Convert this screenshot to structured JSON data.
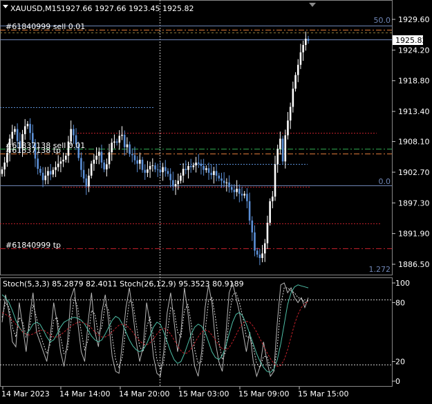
{
  "header": {
    "symbol_label": "XAUUSD,M15",
    "ohlc": "1927.66 1927.66 1923.45 1925.82"
  },
  "price_axis": {
    "ticks": [
      1929.6,
      1924.2,
      1918.8,
      1913.4,
      1908.1,
      1902.7,
      1897.3,
      1891.9,
      1886.5
    ],
    "tick_labels": [
      "1929.60",
      "1924.20",
      "1918.80",
      "1913.40",
      "1908.10",
      "1902.70",
      "1897.30",
      "1891.90",
      "1886.50"
    ],
    "current_price": 1925.82,
    "current_label": "1925.82"
  },
  "time_axis": {
    "labels": [
      "14 Mar 2023",
      "14 Mar 14:00",
      "14 Mar 20:00",
      "15 Mar 03:00",
      "15 Mar 09:00",
      "15 Mar 15:00"
    ]
  },
  "fibo": {
    "high_label": "50.0",
    "mid_label": "0.0",
    "low_label": "1.272"
  },
  "trade_labels": {
    "order1_sell": "#61840999 sell 0.01",
    "order2_sell": "#61837138 sell 0.01",
    "order2_tp": "#61837138 tp",
    "order1_tp": "#61840999 tp"
  },
  "indicator": {
    "title": "Stoch(5,3,3) 85.2879 82.4011  Stoch(26,12,9) 95.3523 80.9189",
    "ticks": [
      100,
      80,
      20,
      0
    ],
    "tick_labels": [
      "100",
      "80",
      "20",
      "0"
    ]
  },
  "colors": {
    "background": "#000000",
    "bull": "#ffffff",
    "bear": "#5b8fd6",
    "grid": "#c8c8c8",
    "fibo": "#6f86b6",
    "sell_level": "#e07b39",
    "tp_level": "#c0202a",
    "green_level": "#2fa84f",
    "stoch_fast_main": "#b8b8b8",
    "stoch_fast_signal": "#e0e0e0",
    "stoch_slow_main": "#4fc0a8",
    "stoch_slow_signal": "#c0202a"
  },
  "chart_data": {
    "type": "candlestick",
    "symbol": "XAUUSD",
    "timeframe": "M15",
    "ylim": [
      1884.5,
      1931.5
    ],
    "x_tick_labels": [
      "14 Mar 2023",
      "14 Mar 14:00",
      "14 Mar 20:00",
      "15 Mar 03:00",
      "15 Mar 09:00",
      "15 Mar 15:00"
    ],
    "close": [
      1903.2,
      1904.4,
      1906.1,
      1908.6,
      1909.8,
      1910.3,
      1908.2,
      1906.9,
      1909.4,
      1910.8,
      1911.2,
      1909.6,
      1907.8,
      1905.1,
      1903.3,
      1902.6,
      1901.3,
      1902.1,
      1902.9,
      1902.3,
      1903.1,
      1903.6,
      1904.2,
      1904.6,
      1904.9,
      1905.6,
      1908.1,
      1910.3,
      1909.2,
      1907.6,
      1905.2,
      1903.1,
      1901.6,
      1900.2,
      1902.1,
      1904.2,
      1904.9,
      1905.6,
      1906.3,
      1904.4,
      1903.2,
      1904.1,
      1906.2,
      1907.9,
      1908.1,
      1907.9,
      1909.1,
      1909.3,
      1907.1,
      1907.6,
      1905.9,
      1905.7,
      1904.8,
      1904.2,
      1904.9,
      1903.1,
      1902.6,
      1903.2,
      1903.8,
      1903.9,
      1903.2,
      1903.1,
      1902.7,
      1903.6,
      1902.9,
      1902.4,
      1901.3,
      1900.2,
      1900.6,
      1901.2,
      1902.1,
      1903.3,
      1903.1,
      1903.8,
      1903.6,
      1903.9,
      1904.4,
      1904.2,
      1903.8,
      1903.1,
      1903.4,
      1902.6,
      1902.2,
      1902.9,
      1902.1,
      1901.6,
      1901.2,
      1900.8,
      1900.9,
      1900.1,
      1899.6,
      1899.2,
      1899.8,
      1898.9,
      1898.6,
      1898.9,
      1897.6,
      1894.2,
      1892.1,
      1888.9,
      1888.2,
      1887.6,
      1888.4,
      1890.2,
      1893.8,
      1897.6,
      1898.4,
      1904.1,
      1906.8,
      1908.6,
      1904.6,
      1909.2,
      1911.8,
      1914.2,
      1917.4,
      1919.8,
      1921.6,
      1923.8,
      1925.1,
      1926.2,
      1925.82
    ],
    "indicator_ylim": [
      0,
      100
    ],
    "series": [
      {
        "name": "Stoch(5,3,3)",
        "last_main": 85.2879,
        "last_signal": 82.4011,
        "main": [
          60,
          88,
          70,
          40,
          35,
          80,
          55,
          30,
          65,
          90,
          50,
          40,
          30,
          20,
          45,
          80,
          60,
          30,
          15,
          40,
          85,
          95,
          60,
          30,
          20,
          60,
          90,
          50,
          35,
          70,
          88,
          60,
          25,
          10,
          8,
          40,
          75,
          95,
          70,
          40,
          20,
          35,
          80,
          60,
          25,
          8,
          5,
          30,
          70,
          90,
          60,
          30,
          50,
          95,
          70,
          40,
          15,
          5,
          30,
          75,
          98,
          80,
          40,
          20,
          10,
          45,
          90,
          100,
          85,
          70,
          50,
          30,
          50,
          20,
          5,
          15,
          40,
          20,
          5,
          10,
          60,
          98,
          100,
          90,
          95,
          85,
          80,
          85,
          75,
          85
        ],
        "signal": [
          65,
          80,
          75,
          55,
          45,
          65,
          60,
          45,
          55,
          78,
          65,
          48,
          38,
          28,
          38,
          62,
          65,
          45,
          28,
          32,
          60,
          85,
          75,
          50,
          32,
          42,
          72,
          68,
          48,
          55,
          78,
          72,
          45,
          22,
          14,
          25,
          55,
          82,
          80,
          58,
          35,
          30,
          55,
          65,
          45,
          22,
          12,
          20,
          48,
          75,
          72,
          50,
          45,
          72,
          78,
          58,
          32,
          18,
          20,
          50,
          82,
          85,
          65,
          40,
          22,
          30,
          65,
          88,
          90,
          80,
          65,
          45,
          45,
          35,
          18,
          14,
          25,
          25,
          14,
          10,
          35,
          78,
          95,
          95,
          92,
          90,
          85,
          84,
          80,
          82
        ]
      },
      {
        "name": "Stoch(26,12,9)",
        "last_main": 95.3523,
        "last_signal": 80.9189,
        "main": [
          88,
          85,
          80,
          72,
          62,
          55,
          50,
          48,
          52,
          58,
          60,
          58,
          52,
          45,
          40,
          42,
          48,
          55,
          60,
          62,
          64,
          65,
          64,
          62,
          58,
          52,
          46,
          42,
          40,
          42,
          48,
          55,
          62,
          66,
          64,
          58,
          50,
          42,
          36,
          32,
          30,
          32,
          38,
          46,
          55,
          60,
          58,
          50,
          40,
          30,
          22,
          18,
          20,
          28,
          38,
          48,
          55,
          58,
          56,
          50,
          40,
          30,
          24,
          22,
          26,
          35,
          48,
          60,
          68,
          70,
          66,
          58,
          48,
          38,
          28,
          20,
          14,
          10,
          9,
          12,
          22,
          38,
          58,
          78,
          90,
          96,
          98,
          97,
          96,
          95
        ],
        "signal": [
          70,
          68,
          66,
          62,
          58,
          54,
          50,
          48,
          47,
          48,
          50,
          52,
          52,
          50,
          47,
          45,
          45,
          47,
          50,
          53,
          56,
          58,
          60,
          60,
          59,
          57,
          54,
          50,
          47,
          45,
          45,
          47,
          50,
          54,
          57,
          58,
          57,
          54,
          50,
          45,
          41,
          38,
          37,
          39,
          43,
          48,
          52,
          54,
          52,
          48,
          42,
          36,
          31,
          28,
          29,
          33,
          39,
          45,
          50,
          52,
          51,
          47,
          42,
          37,
          33,
          32,
          34,
          40,
          47,
          54,
          59,
          61,
          60,
          56,
          50,
          43,
          36,
          29,
          23,
          18,
          15,
          16,
          22,
          32,
          45,
          58,
          68,
          75,
          79,
          81
        ]
      }
    ]
  }
}
